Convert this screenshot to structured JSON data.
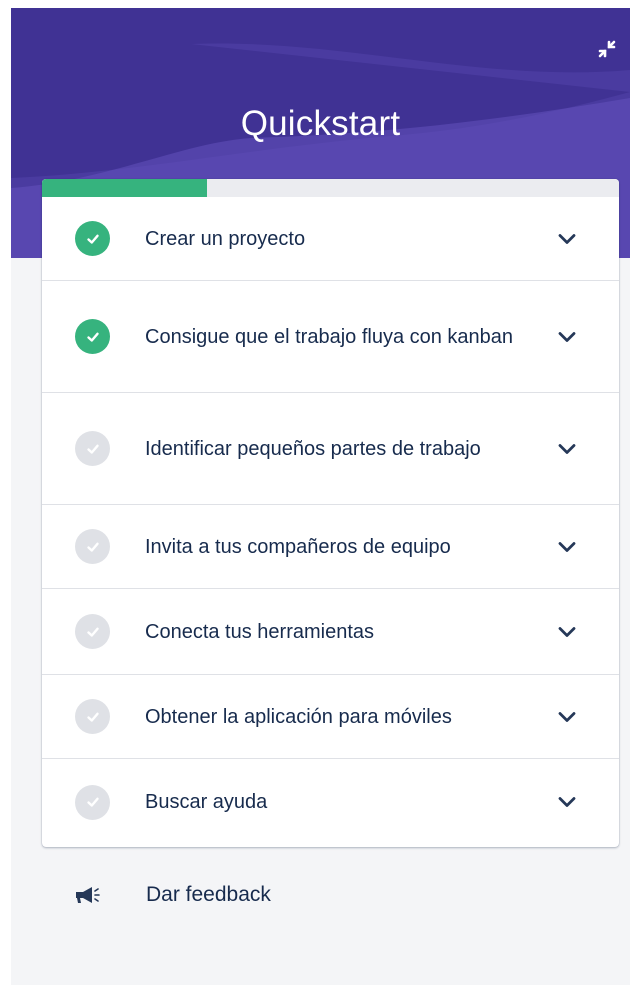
{
  "header": {
    "title": "Quickstart",
    "bg_color": "#403294"
  },
  "progress": {
    "completed": 2,
    "total": 7,
    "fill_color": "#36b37e"
  },
  "items": [
    {
      "label": "Crear un proyecto",
      "done": true
    },
    {
      "label": "Consigue que el trabajo fluya con kanban",
      "done": true
    },
    {
      "label": "Identificar pequeños partes de trabajo",
      "done": false
    },
    {
      "label": "Invita a tus compañeros de equipo",
      "done": false
    },
    {
      "label": "Conecta tus herramientas",
      "done": false
    },
    {
      "label": "Obtener la aplicación para móviles",
      "done": false
    },
    {
      "label": "Buscar ayuda",
      "done": false
    }
  ],
  "feedback": {
    "label": "Dar feedback",
    "icon": "megaphone-icon"
  },
  "icons": {
    "collapse": "collapse-icon",
    "check": "check-icon",
    "chevron": "chevron-down-icon"
  }
}
